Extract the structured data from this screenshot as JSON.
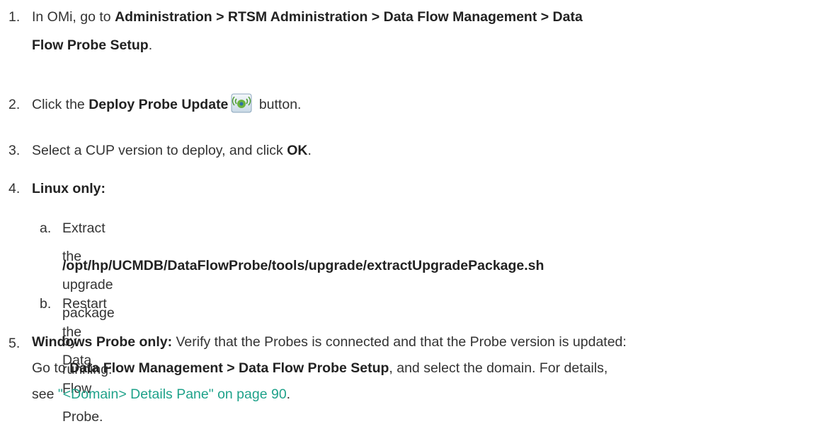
{
  "steps": [
    {
      "num": "1.",
      "pre": "In OMi, go to ",
      "bold": "Administration > RTSM Administration > Data Flow Management > Data",
      "bold2": "Flow Probe Setup",
      "post": "."
    },
    {
      "num": "2.",
      "pre": "Click the ",
      "bold": "Deploy Probe Update",
      "icon": "deploy-probe-update-icon",
      "post": " button."
    },
    {
      "num": "3.",
      "pre": "Select a CUP version to deploy, and click ",
      "bold": "OK",
      "post": "."
    },
    {
      "num": "4.",
      "bold": "Linux only:",
      "substeps": [
        {
          "letter": "a.",
          "text": "Extract the upgrade package by running:",
          "code": "/opt/hp/UCMDB/DataFlowProbe/tools/upgrade/extractUpgradePackage.sh"
        },
        {
          "letter": "b.",
          "text": "Restart the Data Flow Probe."
        }
      ]
    },
    {
      "num": "5.",
      "bold": "Windows Probe only:",
      "line1": " Verify that the Probes is connected and that the Probe version is updated:",
      "line2_pre": "Go to ",
      "line2_bold": "Data Flow Management > Data Flow Probe Setup",
      "line2_post": ", and select the domain. For details,",
      "line3_pre": "see ",
      "link": "\"<Domain> Details Pane\" on page 90",
      "line3_post": "."
    }
  ],
  "colors": {
    "link": "#1fa28a",
    "text": "#333333"
  }
}
